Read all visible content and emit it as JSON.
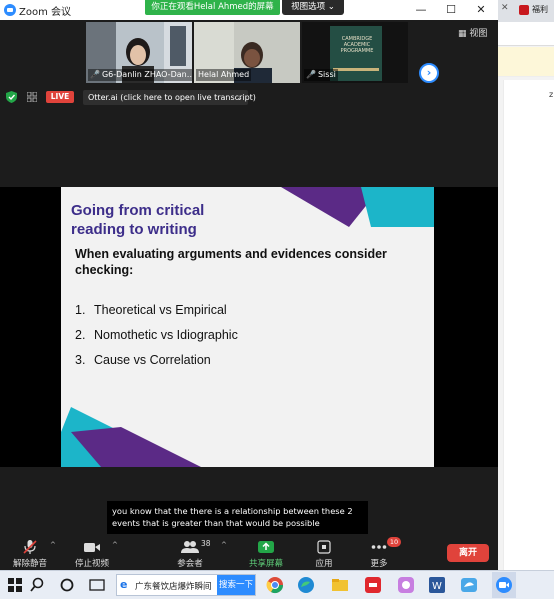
{
  "window": {
    "app_title": "Zoom 会议",
    "viewing_banner": "你正在观看Helal  Ahmed的屏幕",
    "view_options": "视图选项",
    "view_options_caret": "⌄",
    "minimize": "—",
    "maximize": "☐",
    "close": "✕",
    "view_button": "视图"
  },
  "participants": [
    {
      "name": "G6-Danlin ZHAO-Dan…",
      "muted": true
    },
    {
      "name": "Helal Ahmed",
      "muted": false
    },
    {
      "name": "Sissi",
      "muted": true
    }
  ],
  "book_cover": {
    "line1": "CAMBRIDGE",
    "line2": "ACADEMIC",
    "line3": "PROGRAMME"
  },
  "status": {
    "live_label": "LIVE",
    "otter_text": "Otter.ai (click here to open live transcript)",
    "otter_caret": "⌄"
  },
  "slide": {
    "title": "Going from critical\nreading to writing",
    "subtitle": "When evaluating arguments and evidences consider checking:",
    "items": [
      {
        "num": "1.",
        "text": "Theoretical vs Empirical"
      },
      {
        "num": "2.",
        "text": "Nomothetic vs Idiographic"
      },
      {
        "num": "3.",
        "text": "Cause vs Correlation"
      }
    ],
    "colors": {
      "purple": "#5b2a86",
      "teal": "#1cb5c9",
      "title": "#3d2e8a"
    }
  },
  "caption": "you know that the there is a relationship between these 2 events that is greater than that would be possible",
  "toolbar": {
    "unmute": "解除静音",
    "stop_video": "停止视频",
    "participants": "参会者",
    "participant_count": "38",
    "share_screen": "共享屏幕",
    "apps": "应用",
    "more": "更多",
    "more_badge": "10",
    "leave": "离开",
    "caret": "^"
  },
  "browser": {
    "tab_text": "福利",
    "tab_close": "✕",
    "side_char": "z"
  },
  "taskbar": {
    "search_text": "广东餐饮店爆炸瞬间",
    "search_button": "搜索一下",
    "icons": [
      "windows-start",
      "search",
      "cortana",
      "ie",
      "chrome",
      "edge",
      "explorer",
      "app-red",
      "app-pink",
      "word",
      "app-bird",
      "zoom"
    ]
  }
}
